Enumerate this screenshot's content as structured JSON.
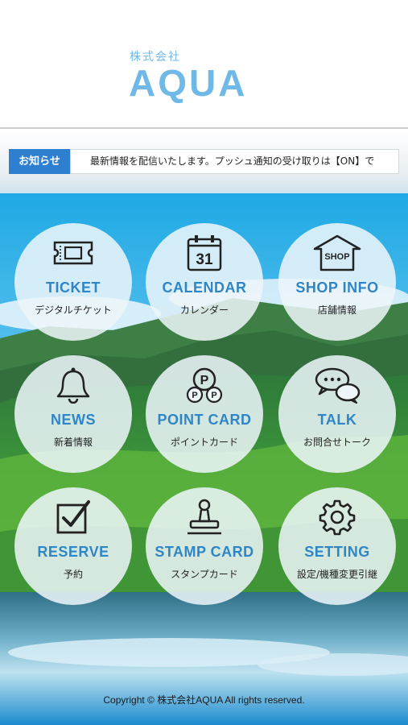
{
  "header": {
    "company_prefix": "株式会社",
    "company_name": "AQUA"
  },
  "notice": {
    "label": "お知らせ",
    "text": "最新情報を配信いたします。プッシュ通知の受け取りは【ON】で"
  },
  "menu": [
    {
      "title": "TICKET",
      "subtitle": "デジタルチケット",
      "icon": "ticket-icon"
    },
    {
      "title": "CALENDAR",
      "subtitle": "カレンダー",
      "icon": "calendar-icon",
      "icon_text": "31"
    },
    {
      "title": "SHOP INFO",
      "subtitle": "店舗情報",
      "icon": "shop-icon",
      "icon_text": "SHOP"
    },
    {
      "title": "NEWS",
      "subtitle": "新着情報",
      "icon": "bell-icon"
    },
    {
      "title": "POINT CARD",
      "subtitle": "ポイントカード",
      "icon": "point-coins-icon",
      "icon_text": "P"
    },
    {
      "title": "TALK",
      "subtitle": "お問合せトーク",
      "icon": "chat-bubbles-icon"
    },
    {
      "title": "RESERVE",
      "subtitle": "予約",
      "icon": "checkbox-icon"
    },
    {
      "title": "STAMP CARD",
      "subtitle": "スタンプカード",
      "icon": "stamp-icon"
    },
    {
      "title": "SETTING",
      "subtitle": "設定/機種変更引継",
      "icon": "gear-icon"
    }
  ],
  "footer": {
    "copyright": "Copyright © 株式会社AQUA All rights reserved."
  },
  "colors": {
    "brand": "#6fb9e8",
    "accent_blue": "#2f86c6",
    "notice_label_bg": "#2f7fd0"
  }
}
